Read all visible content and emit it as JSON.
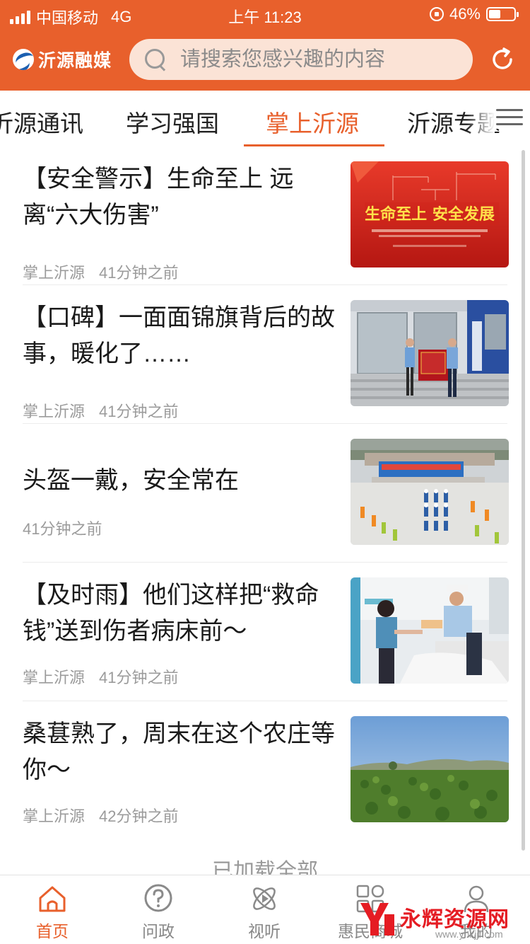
{
  "status_bar": {
    "carrier": "中国移动",
    "network": "4G",
    "time": "上午 11:23",
    "battery": "46%",
    "battery_level": 0.46
  },
  "header": {
    "logo_text": "沂源融媒",
    "search_placeholder": "请搜索您感兴趣的内容",
    "accent_color": "#e8602c"
  },
  "tabs": [
    {
      "label": "沂源通讯",
      "active": false
    },
    {
      "label": "学习强国",
      "active": false
    },
    {
      "label": "掌上沂源",
      "active": true
    },
    {
      "label": "沂源专题",
      "active": false
    }
  ],
  "articles": [
    {
      "title": "【安全警示】生命至上 远离“六大伤害”",
      "source": "掌上沂源",
      "time": "41分钟之前",
      "image": "banner 生命至上 安全发展",
      "image_text": "生命至上 安全发展"
    },
    {
      "title": "【口碑】一面面锦旗背后的故事，暖化了……",
      "source": "掌上沂源",
      "time": "41分钟之前",
      "image": "police station banner photo"
    },
    {
      "title": "头盔一戴，安全常在",
      "source": "",
      "time": "41分钟之前",
      "image": "square event photo"
    },
    {
      "title": "【及时雨】他们这样把“救命钱”送到伤者病床前～",
      "source": "掌上沂源",
      "time": "41分钟之前",
      "image": "hospital ward photo"
    },
    {
      "title": "桑葚熟了，周末在这个农庄等你～",
      "source": "掌上沂源",
      "time": "42分钟之前",
      "image": "farm field photo"
    }
  ],
  "list_footer": "已加载全部",
  "bottom_nav": [
    {
      "label": "首页",
      "icon": "home-icon",
      "active": true
    },
    {
      "label": "问政",
      "icon": "question-icon",
      "active": false
    },
    {
      "label": "视听",
      "icon": "play-atom-icon",
      "active": false
    },
    {
      "label": "惠民商城",
      "icon": "grid-icon",
      "active": false
    },
    {
      "label": "我的",
      "icon": "person-icon",
      "active": false
    }
  ],
  "watermark": {
    "text": "永辉资源网",
    "url": "www.yhkjjf.com"
  }
}
